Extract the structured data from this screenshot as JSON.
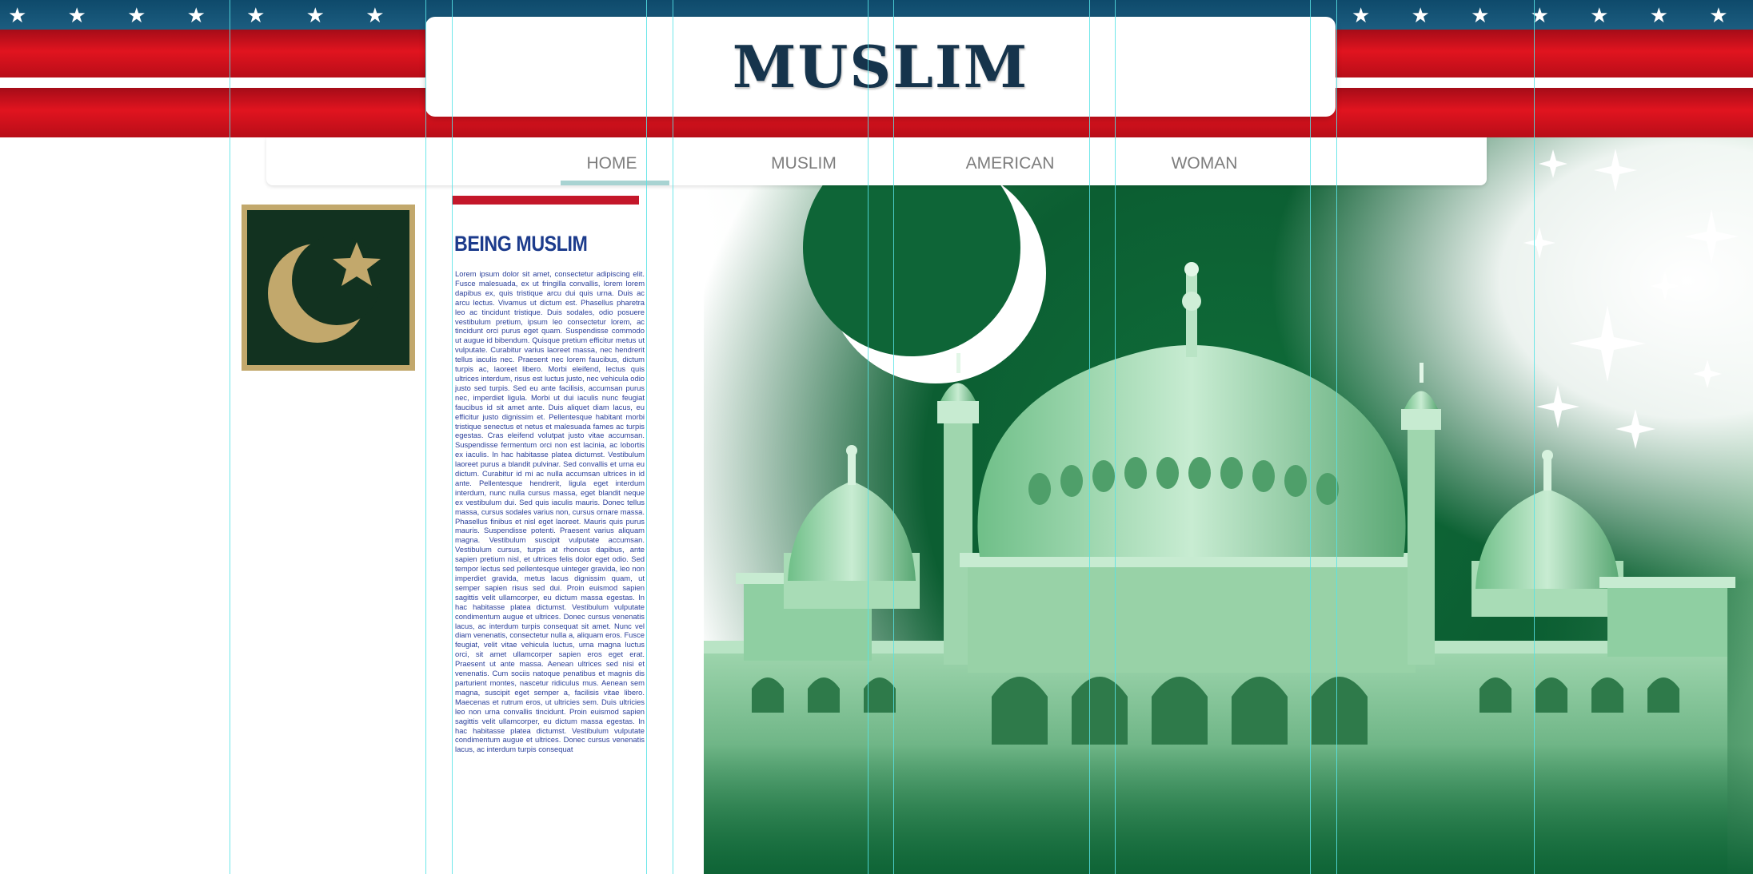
{
  "header": {
    "title": "MUSLIM",
    "stars_left": "★ ★ ★ ★ ★ ★ ★ ★ ★ ★ ★",
    "stars_right": "★ ★ ★ ★ ★ ★ ★ ★ ★ ★"
  },
  "nav": {
    "items": [
      {
        "label": "HOME",
        "active": true
      },
      {
        "label": "MUSLIM"
      },
      {
        "label": "AMERICAN"
      },
      {
        "label": "WOMAN"
      }
    ]
  },
  "article": {
    "title": "BEING MUSLIM",
    "body": "Lorem ipsum dolor sit amet, consectetur adipiscing elit. Fusce malesuada, ex ut fringilla convallis, lorem lorem dapibus ex, quis tristique arcu dui quis urna. Duis ac arcu lectus. Vivamus ut dictum est. Phasellus pharetra leo ac tincidunt tristique. Duis sodales, odio posuere vestibulum pretium, ipsum leo consectetur lorem, ac tincidunt orci purus eget quam. Suspendisse commodo ut augue id bibendum. Quisque pretium efficitur metus ut vulputate. Curabitur varius laoreet massa, nec hendrerit tellus iaculis nec. Praesent nec lorem faucibus, dictum turpis ac, laoreet libero. Morbi eleifend, lectus quis ultrices interdum, risus est luctus justo, nec vehicula odio justo sed turpis. Sed eu ante facilisis, accumsan purus nec, imperdiet ligula. Morbi ut dui iaculis nunc feugiat faucibus id sit amet ante. Duis aliquet diam lacus, eu efficitur justo dignissim et. Pellentesque habitant morbi tristique senectus et netus et malesuada fames ac turpis egestas. Cras eleifend volutpat justo vitae accumsan. Suspendisse fermentum orci non est lacinia, ac lobortis ex iaculis. In hac habitasse platea dictumst. Vestibulum laoreet purus a blandit pulvinar. Sed convallis et urna eu dictum. Curabitur id mi ac nulla accumsan ultrices in id ante. Pellentesque hendrerit, ligula eget interdum interdum, nunc nulla cursus massa, eget blandit neque ex vestibulum dui. Sed quis iaculis mauris. Donec tellus massa, cursus sodales varius non, cursus ornare massa. Phasellus finibus et nisl eget laoreet. Mauris quis purus mauris. Suspendisse potenti. Praesent varius aliquam magna. Vestibulum suscipit vulputate accumsan. Vestibulum cursus, turpis at rhoncus dapibus, ante sapien pretium nisl, et ultrices felis dolor eget odio. Sed tempor lectus sed pellentesque uinteger gravida, leo non imperdiet gravida, metus lacus dignissim quam, ut semper sapien risus sed dui. Proin euismod sapien sagittis velit ullamcorper, eu dictum massa egestas. In hac habitasse platea dictumst. Vestibulum vulputate condimentum augue et ultrices. Donec cursus venenatis lacus, ac interdum turpis consequat sit amet. Nunc vel diam venenatis, consectetur nulla a, aliquam eros. Fusce feugiat, velit vitae vehicula luctus, urna magna luctus orci, sit amet ullamcorper sapien eros eget erat. Praesent ut ante massa. Aenean ultrices sed nisi et venenatis. Cum sociis natoque penatibus et magnis dis parturient montes, nascetur ridiculus mus. Aenean sem magna, suscipit eget semper a, facilisis vitae libero. Maecenas et rutrum eros, ut ultricies sem. Duis ultricies leo non urna convallis tincidunt. Proin euismod sapien sagittis velit ullamcorper, eu dictum massa egestas. In hac habitasse platea dictumst. Vestibulum vulputate condimentum augue et ultrices. Donec cursus venenatis lacus, ac interdum turpis consequat"
  },
  "icons": {
    "emblem": "crescent-star-icon",
    "hero": "mosque-hero-image"
  },
  "colors": {
    "flag_blue": "#0e4a6b",
    "flag_red": "#d4111d",
    "title_navy": "#16344c",
    "article_blue": "#1c3b8c",
    "accent_red": "#c4172a",
    "nav_underline": "#a8d3d2",
    "hero_green": "#0d6235",
    "guide_cyan": "#57e3e6"
  }
}
